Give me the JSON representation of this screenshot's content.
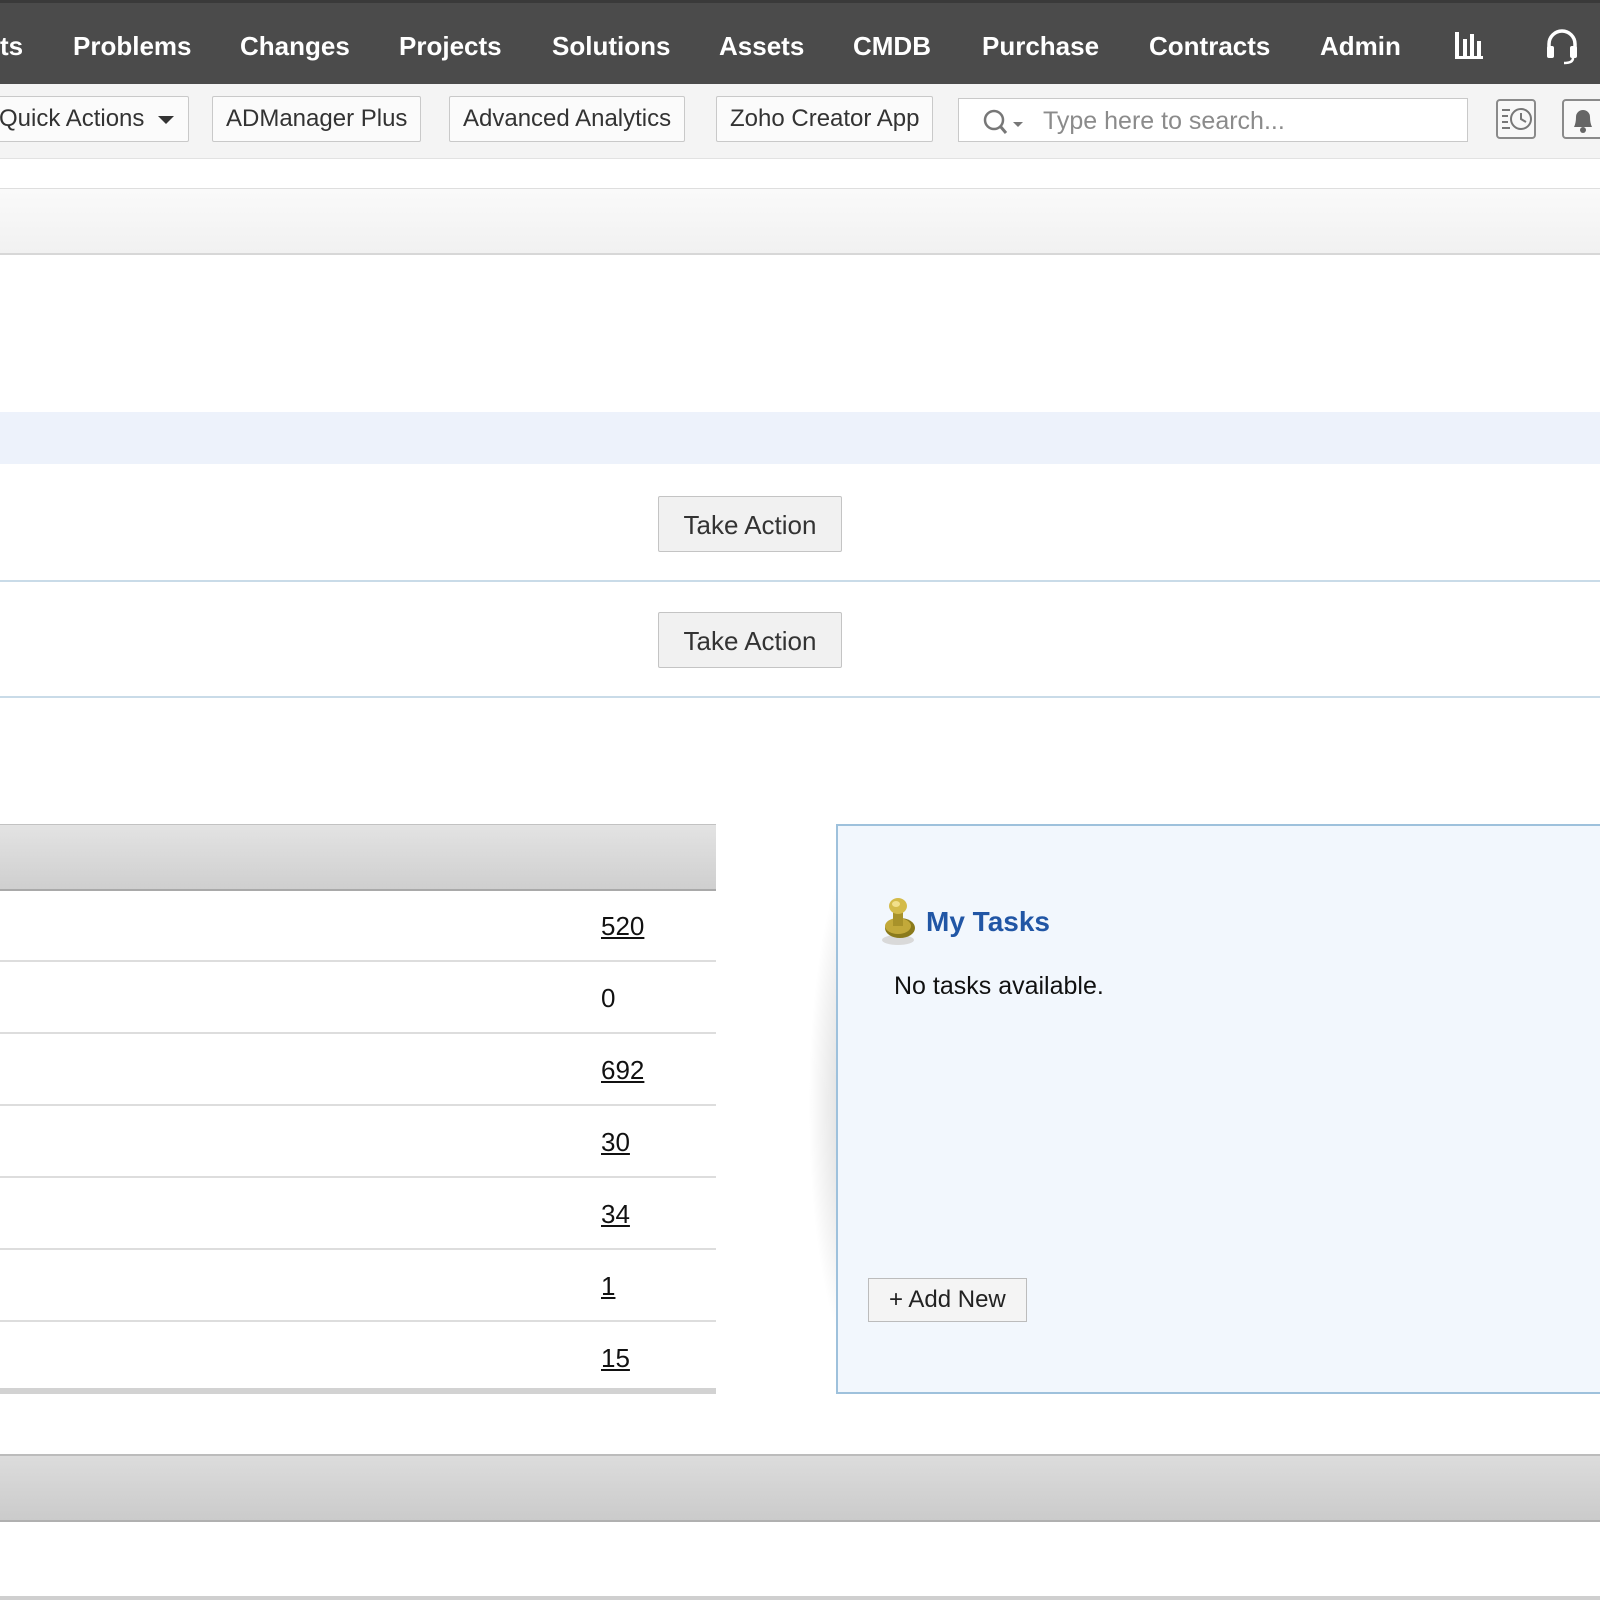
{
  "nav": {
    "items": [
      {
        "key": "requests",
        "label": "ts"
      },
      {
        "key": "problems",
        "label": "Problems"
      },
      {
        "key": "changes",
        "label": "Changes"
      },
      {
        "key": "projects",
        "label": "Projects"
      },
      {
        "key": "solutions",
        "label": "Solutions"
      },
      {
        "key": "assets",
        "label": "Assets"
      },
      {
        "key": "cmdb",
        "label": "CMDB"
      },
      {
        "key": "purchase",
        "label": "Purchase"
      },
      {
        "key": "contracts",
        "label": "Contracts"
      },
      {
        "key": "admin",
        "label": "Admin"
      }
    ],
    "icons": [
      "reports-icon",
      "headset-icon"
    ]
  },
  "toolbar": {
    "quick_actions": "Quick Actions",
    "links": [
      "ADManager Plus",
      "Advanced Analytics",
      "Zoho Creator App"
    ],
    "search_placeholder": "Type here to search...",
    "icons": [
      "search-icon",
      "recent-history-icon",
      "notification-bell-icon"
    ]
  },
  "actions": {
    "take_action_1": "Take Action",
    "take_action_2": "Take Action"
  },
  "stats": {
    "rows": [
      {
        "value": "520",
        "link": true
      },
      {
        "value": "0",
        "link": false
      },
      {
        "value": "692",
        "link": true
      },
      {
        "value": "30",
        "link": true
      },
      {
        "value": "34",
        "link": true
      },
      {
        "value": "1",
        "link": true
      },
      {
        "value": "15",
        "link": true
      }
    ]
  },
  "tasks": {
    "title": "My Tasks",
    "empty_text": "No tasks available.",
    "add_new": "+ Add New",
    "accent": "#2156a5"
  },
  "colors": {
    "nav_bg": "#4b4b4b",
    "panel_bg": "#f2f7fd",
    "panel_border": "#9ec1dc"
  }
}
